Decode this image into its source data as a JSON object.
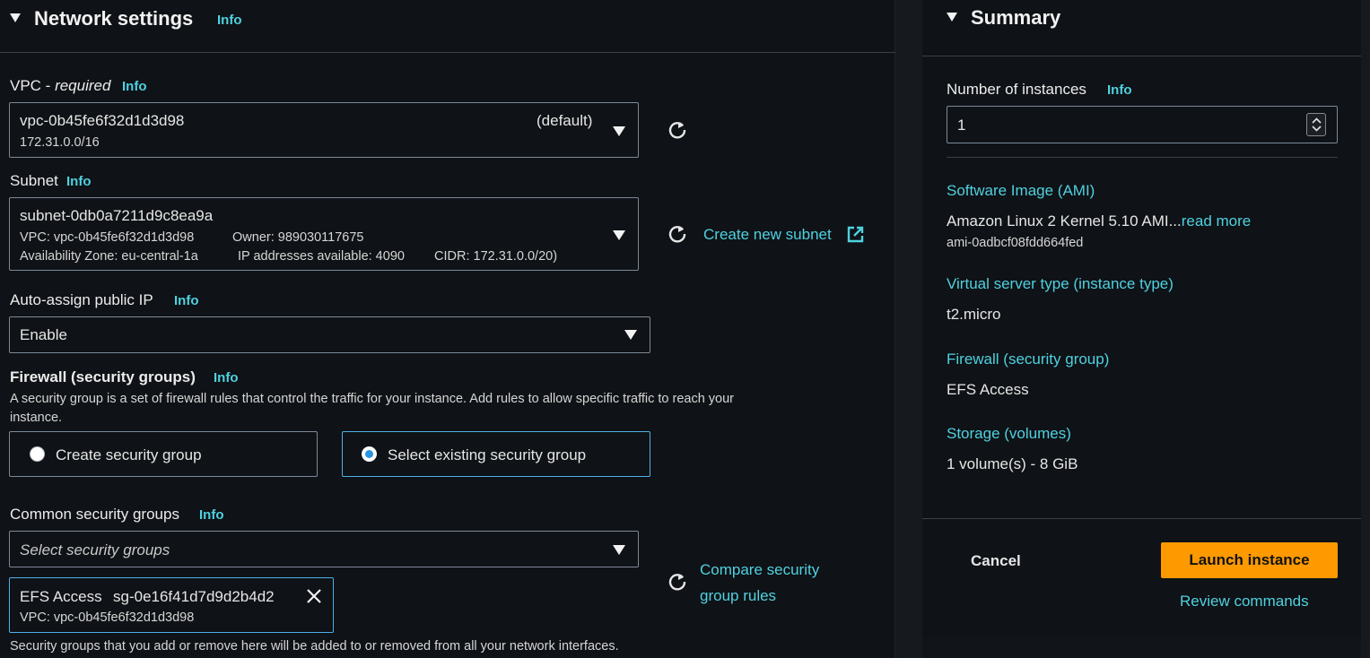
{
  "network": {
    "title": "Network settings",
    "info": "Info",
    "vpc": {
      "label": "VPC - ",
      "label_required": "required",
      "info": "Info",
      "value": "vpc-0b45fe6f32d1d3d98",
      "suffix": "(default)",
      "cidr": "172.31.0.0/16"
    },
    "subnet": {
      "label": "Subnet",
      "info": "Info",
      "value": "subnet-0db0a7211d9c8ea9a",
      "vpc_line": "VPC: vpc-0b45fe6f32d1d3d98",
      "owner_line": "Owner: 989030117675",
      "az_line": "Availability Zone: eu-central-1a",
      "ip_line": "IP addresses available: 4090",
      "cidr_line": "CIDR: 172.31.0.0/20)",
      "create_link": "Create new subnet"
    },
    "public_ip": {
      "label": "Auto-assign public IP",
      "info": "Info",
      "value": "Enable"
    },
    "firewall": {
      "label": "Firewall (security groups)",
      "info": "Info",
      "description_line1": "A security group is a set of firewall rules that control the traffic for your instance. Add rules to allow specific traffic to reach your",
      "description_line2": "instance.",
      "option_create": "Create security group",
      "option_existing": "Select existing security group",
      "selected": "Select existing security group"
    },
    "common_sg": {
      "label": "Common security groups",
      "info": "Info",
      "placeholder": "Select security groups",
      "compare_line1": "Compare security",
      "compare_line2": "group rules",
      "token_name": "EFS Access",
      "token_id": "sg-0e16f41d7d9d2b4d2",
      "token_vpc": "VPC: vpc-0b45fe6f32d1d3d98",
      "footnote": "Security groups that you add or remove here will be added to or removed from all your network interfaces."
    }
  },
  "summary": {
    "title": "Summary",
    "instances_label": "Number of instances",
    "instances_info": "Info",
    "instances_value": "1",
    "ami_label": "Software Image (AMI)",
    "ami_value": "Amazon Linux 2 Kernel 5.10 AMI...",
    "ami_read_more": "read more",
    "ami_id": "ami-0adbcf08fdd664fed",
    "instance_type_label": "Virtual server type (instance type)",
    "instance_type_value": "t2.micro",
    "firewall_label": "Firewall (security group)",
    "firewall_value": "EFS Access",
    "storage_label": "Storage (volumes)",
    "storage_value": "1 volume(s) - 8 GiB",
    "cancel_label": "Cancel",
    "launch_label": "Launch instance",
    "review_label": "Review commands"
  },
  "colors": {
    "accent_link": "#4fd1e0",
    "launch_button": "#ff9900",
    "selected_border": "#4fb0e8"
  }
}
